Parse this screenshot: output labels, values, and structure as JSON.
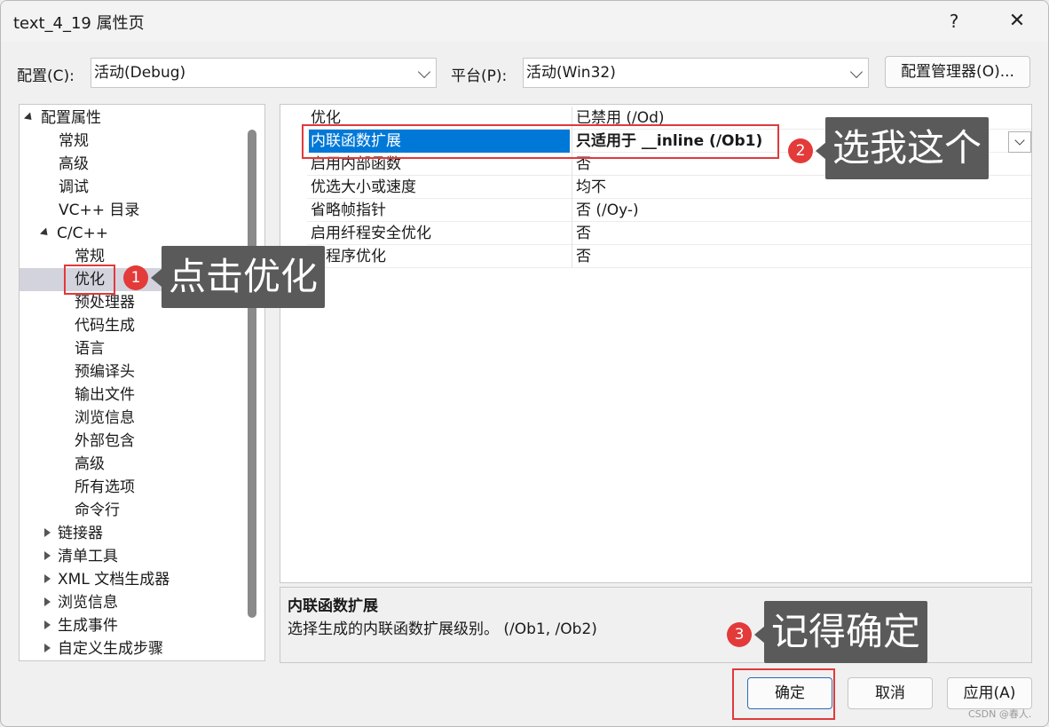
{
  "window": {
    "title": "text_4_19 属性页",
    "help_label": "?",
    "close_label": "✕"
  },
  "config_bar": {
    "config_label": "配置(C):",
    "config_value": "活动(Debug)",
    "platform_label": "平台(P):",
    "platform_value": "活动(Win32)",
    "manager_button": "配置管理器(O)..."
  },
  "tree": {
    "items": [
      {
        "label": "配置属性"
      },
      {
        "label": "常规"
      },
      {
        "label": "高级"
      },
      {
        "label": "调试"
      },
      {
        "label": "VC++ 目录"
      },
      {
        "label": "C/C++"
      },
      {
        "label": "常规"
      },
      {
        "label": "优化"
      },
      {
        "label": "预处理器"
      },
      {
        "label": "代码生成"
      },
      {
        "label": "语言"
      },
      {
        "label": "预编译头"
      },
      {
        "label": "输出文件"
      },
      {
        "label": "浏览信息"
      },
      {
        "label": "外部包含"
      },
      {
        "label": "高级"
      },
      {
        "label": "所有选项"
      },
      {
        "label": "命令行"
      },
      {
        "label": "链接器"
      },
      {
        "label": "清单工具"
      },
      {
        "label": "XML 文档生成器"
      },
      {
        "label": "浏览信息"
      },
      {
        "label": "生成事件"
      },
      {
        "label": "自定义生成步骤"
      }
    ]
  },
  "grid": {
    "rows": [
      {
        "name": "优化",
        "value": "已禁用 (/Od)"
      },
      {
        "name": "内联函数扩展",
        "value": "只适用于 __inline (/Ob1)"
      },
      {
        "name": "启用内部函数",
        "value": "否"
      },
      {
        "name": "优选大小或速度",
        "value": "均不"
      },
      {
        "name": "省略帧指针",
        "value": "否 (/Oy-)"
      },
      {
        "name": "启用纤程安全优化",
        "value": "否"
      },
      {
        "name": "全程序优化",
        "value": "否"
      }
    ]
  },
  "description": {
    "title": "内联函数扩展",
    "text": "选择生成的内联函数扩展级别。    (/Ob1, /Ob2)"
  },
  "buttons": {
    "ok": "确定",
    "cancel": "取消",
    "apply": "应用(A)"
  },
  "annotations": {
    "step1_number": "1",
    "step1_text": "点击优化",
    "step2_number": "2",
    "step2_text": "选我这个",
    "step3_number": "3",
    "step3_text": "记得确定",
    "color": "#e33a3a"
  },
  "watermark": "CSDN @春人."
}
